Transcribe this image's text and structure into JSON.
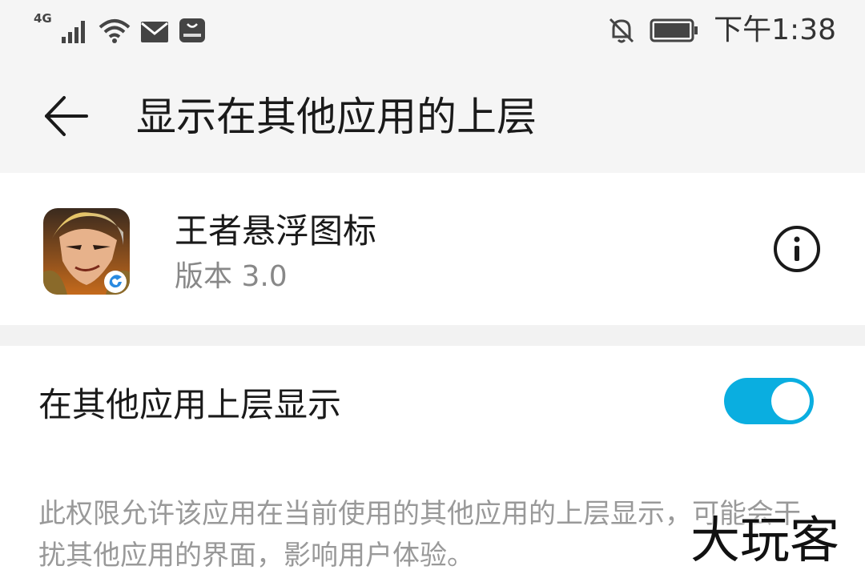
{
  "status_bar": {
    "network": "4G",
    "time": "下午1:38",
    "icons": [
      "signal-icon",
      "wifi-icon",
      "mail-icon",
      "huawei-store-icon",
      "notifications-off-icon",
      "battery-icon"
    ]
  },
  "header": {
    "back_icon": "back-arrow-icon",
    "title": "显示在其他应用的上层"
  },
  "app": {
    "name": "王者悬浮图标",
    "version": "版本 3.0",
    "info_icon": "info-icon"
  },
  "setting": {
    "label": "在其他应用上层显示",
    "enabled": true
  },
  "description": "此权限允许该应用在当前使用的其他应用的上层显示，可能会干扰其他应用的界面，影响用户体验。",
  "watermark": "大玩客",
  "colors": {
    "accent": "#0aaee0",
    "background": "#f5f5f5",
    "card": "#ffffff",
    "secondary_text": "#888888"
  }
}
